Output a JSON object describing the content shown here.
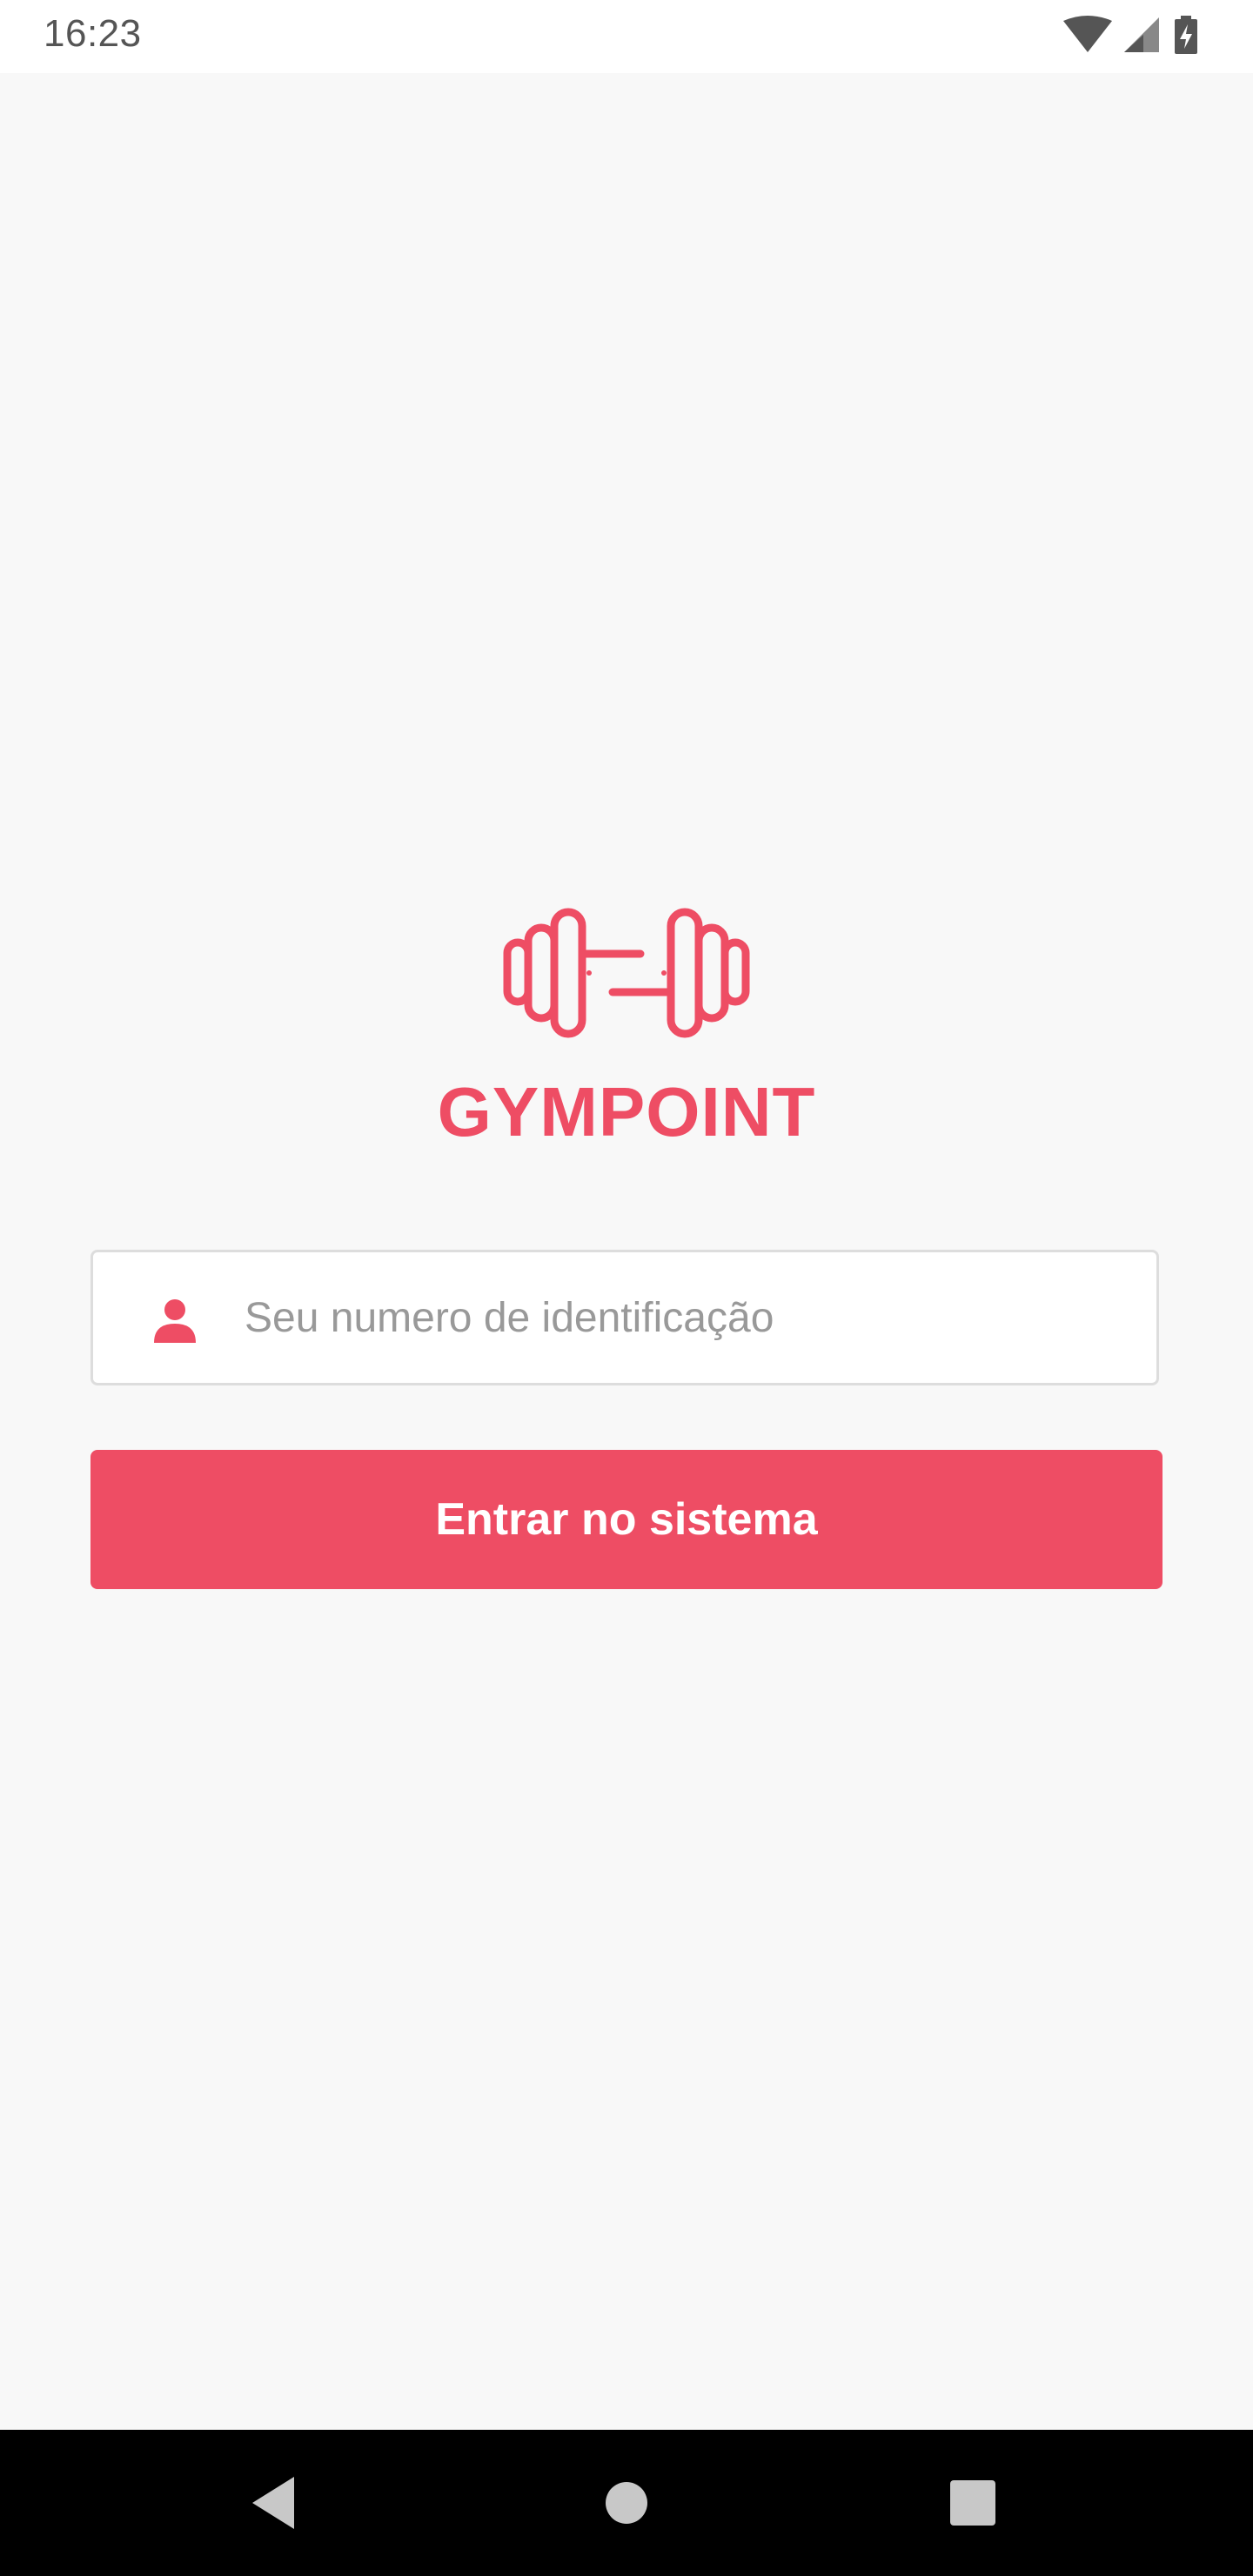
{
  "status_bar": {
    "time": "16:23",
    "icons": [
      "wifi-icon",
      "signal-icon",
      "battery-charging-icon"
    ]
  },
  "login": {
    "logo_icon": "dumbbell-icon",
    "app_name": "GYMPOINT",
    "id_field": {
      "icon": "user-icon",
      "placeholder": "Seu numero de identificação",
      "value": ""
    },
    "submit_label": "Entrar no sistema"
  },
  "nav_bar": {
    "buttons": [
      "back-icon",
      "home-icon",
      "recents-icon"
    ]
  },
  "colors": {
    "brand": "#ee4d64",
    "background": "#f8f8f8",
    "input_border": "#dddddd",
    "placeholder": "#999999"
  }
}
